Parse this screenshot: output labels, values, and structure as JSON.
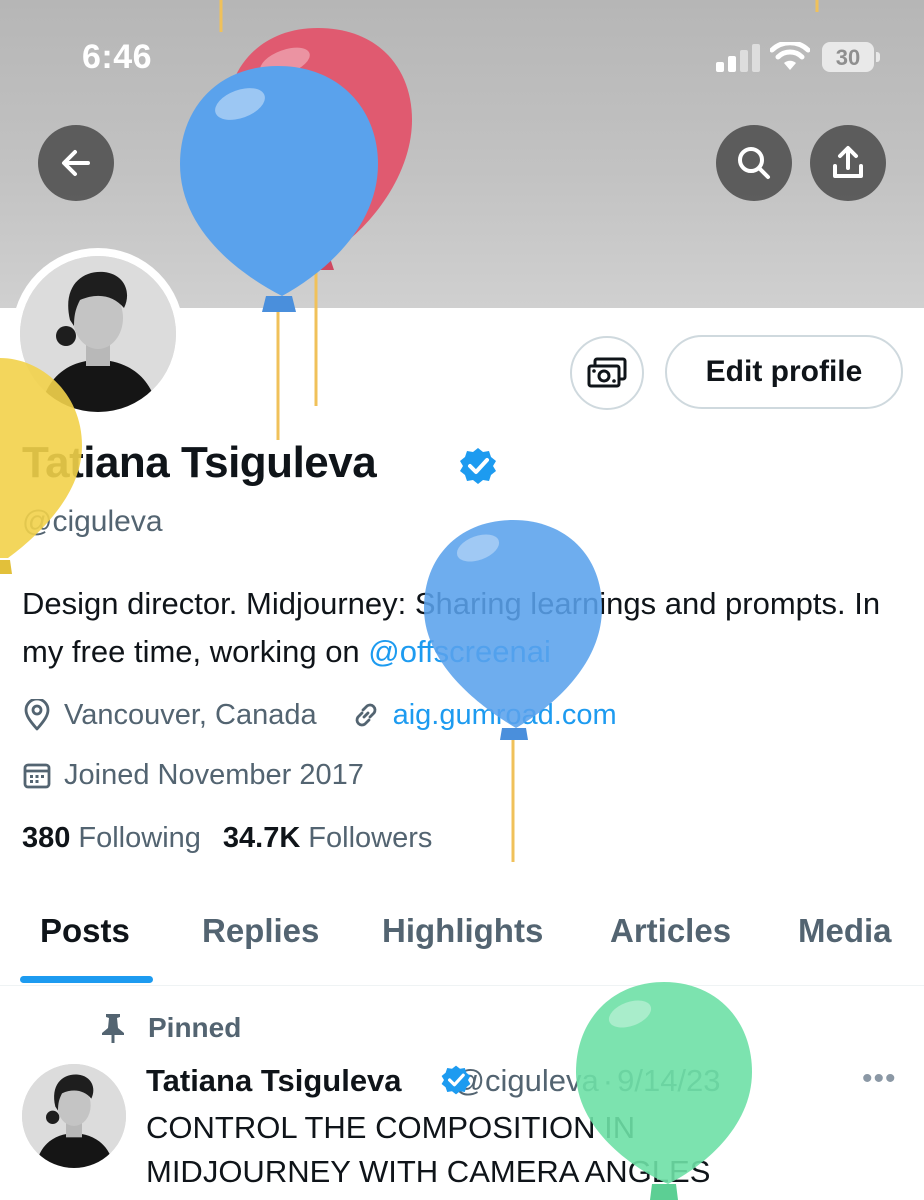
{
  "status_bar": {
    "time": "6:46",
    "battery": "30"
  },
  "header": {
    "back_icon": "arrow-left-icon",
    "search_icon": "search-icon",
    "share_icon": "share-icon"
  },
  "profile": {
    "money_icon": "money-icon",
    "edit_label": "Edit profile",
    "display_name": "Tatiana Tsiguleva",
    "handle": "@ciguleva",
    "bio_text": "Design director. Midjourney: Sharing learnings and prompts. In my free time, working on ",
    "bio_mention": "@offscreenai",
    "location": "Vancouver, Canada",
    "website": "aig.gumroad.com",
    "joined": "Joined November 2017",
    "following_count": "380",
    "following_label": "Following",
    "followers_count": "34.7K",
    "followers_label": "Followers"
  },
  "tabs": [
    {
      "label": "Posts",
      "active": true
    },
    {
      "label": "Replies"
    },
    {
      "label": "Highlights"
    },
    {
      "label": "Articles"
    },
    {
      "label": "Media"
    }
  ],
  "pinned_post": {
    "pinned_label": "Pinned",
    "author_name": "Tatiana Tsiguleva",
    "author_handle": "@ciguleva",
    "separator": "·",
    "date": "9/14/23",
    "more": "•••",
    "text": "CONTROL THE COMPOSITION IN MIDJOURNEY WITH CAMERA ANGLES"
  },
  "colors": {
    "accent": "#1d9bf0",
    "text_primary": "#0f1419",
    "text_secondary": "#536471",
    "balloon_red": "#e05a70",
    "balloon_blue": "#5aa2ec",
    "balloon_yellow": "#f2d24a",
    "balloon_green": "#6ee0a6"
  }
}
